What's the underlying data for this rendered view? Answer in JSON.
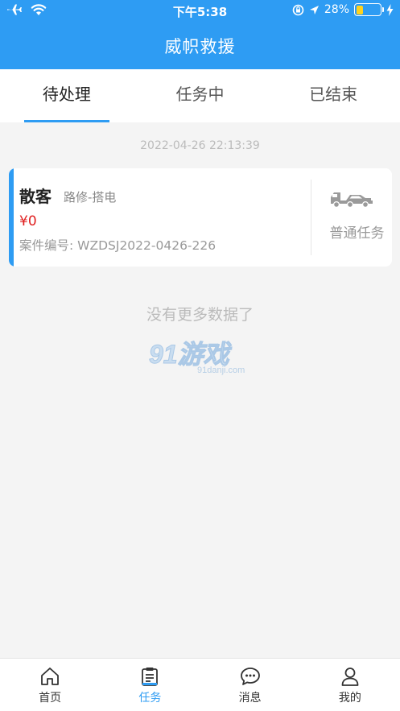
{
  "status_bar": {
    "time": "下午5:38",
    "battery": "28%",
    "battery_level": 0.28
  },
  "header": {
    "title": "威帜救援"
  },
  "tabs": [
    {
      "label": "待处理",
      "active": true
    },
    {
      "label": "任务中",
      "active": false
    },
    {
      "label": "已结束",
      "active": false
    }
  ],
  "orders": [
    {
      "time": "2022-04-26 22:13:39",
      "customer": "散客",
      "service": "路修-搭电",
      "price": "¥0",
      "case_number": "案件编号: WZDSJ2022-0426-226",
      "task_type": "普通任务"
    }
  ],
  "list_end": "没有更多数据了",
  "watermark": {
    "logo": "91游戏",
    "domain": "91danji.com"
  },
  "bottom_nav": [
    {
      "label": "首页",
      "icon": "home-icon",
      "active": false
    },
    {
      "label": "任务",
      "icon": "clipboard-icon",
      "active": true
    },
    {
      "label": "消息",
      "icon": "chat-icon",
      "active": false
    },
    {
      "label": "我的",
      "icon": "user-icon",
      "active": false
    }
  ],
  "colors": {
    "brand": "#2e9cf3",
    "price": "#e02020",
    "battery": "#ffd21e"
  }
}
